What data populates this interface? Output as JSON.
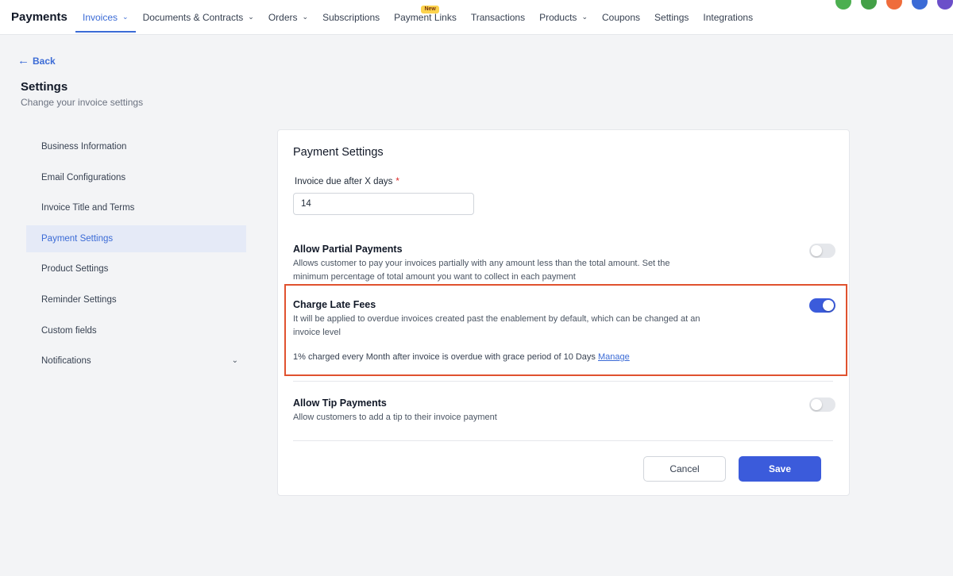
{
  "app": {
    "title": "Payments"
  },
  "nav": {
    "items": [
      {
        "label": "Invoices",
        "has_dropdown": true,
        "active": true
      },
      {
        "label": "Documents & Contracts",
        "has_dropdown": true
      },
      {
        "label": "Orders",
        "has_dropdown": true
      },
      {
        "label": "Subscriptions"
      },
      {
        "label": "Payment Links",
        "badge": "New"
      },
      {
        "label": "Transactions"
      },
      {
        "label": "Products",
        "has_dropdown": true
      },
      {
        "label": "Coupons"
      },
      {
        "label": "Settings"
      },
      {
        "label": "Integrations"
      }
    ],
    "avatar_colors": [
      "#4caf50",
      "#43a047",
      "#ef6c3b",
      "#3b6bd6",
      "#6b4fc9"
    ]
  },
  "header": {
    "back_label": "Back",
    "title": "Settings",
    "subtitle": "Change your invoice settings"
  },
  "sidebar": {
    "items": [
      {
        "label": "Business Information"
      },
      {
        "label": "Email Configurations"
      },
      {
        "label": "Invoice Title and Terms"
      },
      {
        "label": "Payment Settings",
        "active": true
      },
      {
        "label": "Product Settings"
      },
      {
        "label": "Reminder Settings"
      },
      {
        "label": "Custom fields"
      },
      {
        "label": "Notifications",
        "has_dropdown": true
      }
    ]
  },
  "payment_settings": {
    "title": "Payment Settings",
    "due_days": {
      "label": "Invoice due after X days",
      "required_mark": "*",
      "value": "14"
    },
    "partial_payments": {
      "title": "Allow Partial Payments",
      "description": "Allows customer to pay your invoices partially with any amount less than the total amount. Set the minimum percentage of total amount you want to collect in each payment",
      "enabled": false
    },
    "late_fees": {
      "title": "Charge Late Fees",
      "description": "It will be applied to overdue invoices created past the enablement by default, which can be changed at an invoice level",
      "summary": "1% charged every Month after invoice is overdue with grace period of 10 Days",
      "manage_label": "Manage",
      "enabled": true
    },
    "tip_payments": {
      "title": "Allow Tip Payments",
      "description": "Allow customers to add a tip to their invoice payment",
      "enabled": false
    },
    "cancel_label": "Cancel",
    "save_label": "Save"
  },
  "colors": {
    "accent": "#3b5bdb",
    "link": "#3b6bd6",
    "highlight_border": "#e0522f",
    "active_sidebar_bg": "#e5eaf7"
  },
  "icons": {
    "back": "arrow-left-icon",
    "dropdown": "chevron-down-icon"
  }
}
